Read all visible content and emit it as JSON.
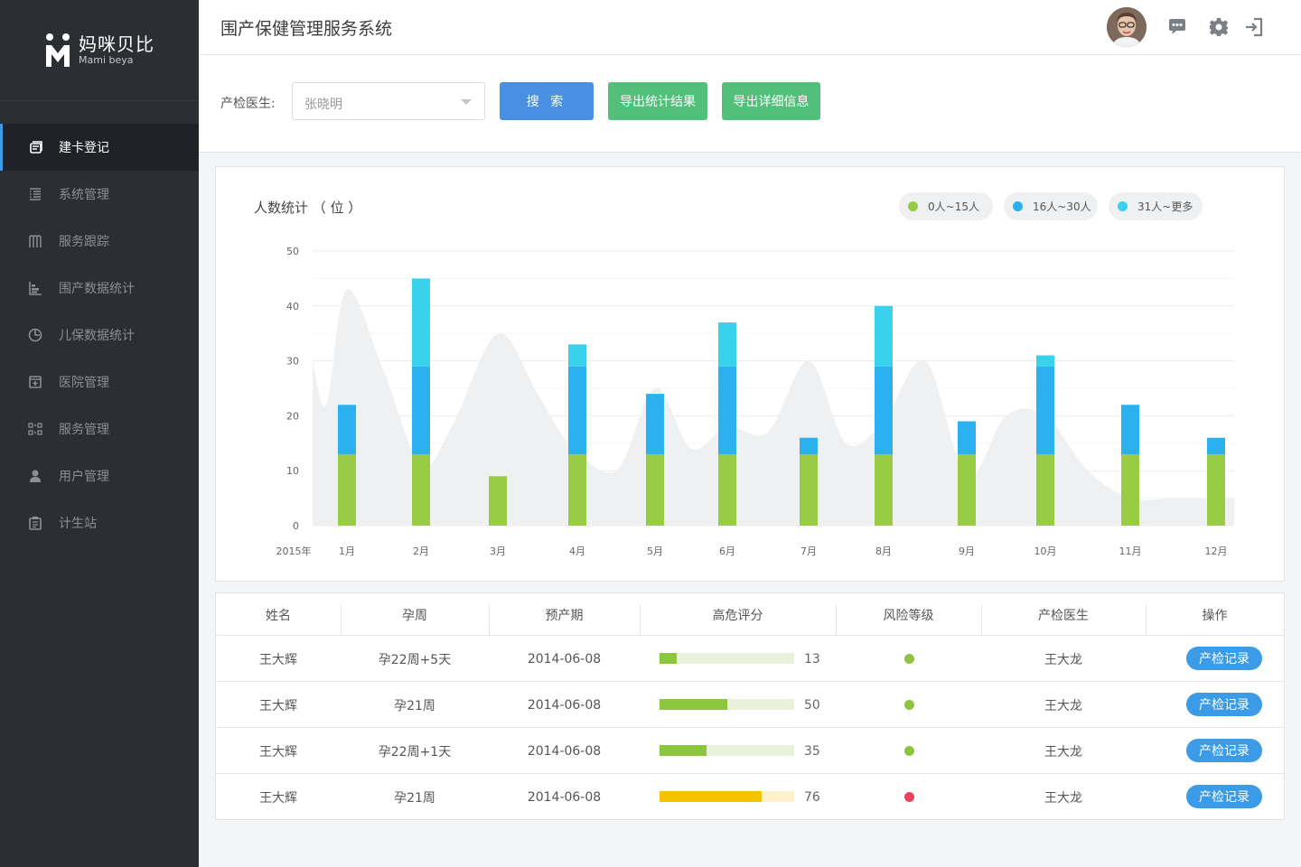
{
  "brand": {
    "name_cn": "妈咪贝比",
    "name_en": "Mami beya"
  },
  "sidebar": {
    "items": [
      {
        "label": "建卡登记",
        "icon": "card-icon",
        "active": true
      },
      {
        "label": "系统管理",
        "icon": "list-icon",
        "active": false
      },
      {
        "label": "服务跟踪",
        "icon": "track-icon",
        "active": false
      },
      {
        "label": "围产数据统计",
        "icon": "bar-chart-icon",
        "active": false
      },
      {
        "label": "儿保数据统计",
        "icon": "pie-chart-icon",
        "active": false
      },
      {
        "label": "医院管理",
        "icon": "hospital-icon",
        "active": false
      },
      {
        "label": "服务管理",
        "icon": "service-icon",
        "active": false
      },
      {
        "label": "用户管理",
        "icon": "user-icon",
        "active": false
      },
      {
        "label": "计生站",
        "icon": "clipboard-icon",
        "active": false
      }
    ]
  },
  "header": {
    "title": "围产保健管理服务系统"
  },
  "filter": {
    "label": "产检医生:",
    "doctor_value": "张晓明",
    "search_label": "搜 索",
    "export_stats_label": "导出统计结果",
    "export_detail_label": "导出详细信息"
  },
  "colors": {
    "green": "#99cc45",
    "blue": "#2bb1f0",
    "cyan": "#38d2ec",
    "area": "#eef0f2",
    "accent": "#3b9be6",
    "risk_low": "#8cc63f",
    "risk_high": "#f0405a"
  },
  "chart_data": {
    "type": "bar",
    "title": "人数统计 （ 位 ）",
    "x_origin_label": "2015年",
    "categories": [
      "1月",
      "2月",
      "3月",
      "4月",
      "5月",
      "6月",
      "7月",
      "8月",
      "9月",
      "10月",
      "11月",
      "12月"
    ],
    "stacked": true,
    "ylim": [
      0,
      50
    ],
    "yticks": [
      0,
      10,
      20,
      30,
      40,
      50
    ],
    "series": [
      {
        "name": "0人~15人",
        "color": "#99cc45",
        "values": [
          13,
          13,
          9,
          13,
          13,
          13,
          13,
          13,
          13,
          13,
          13,
          13
        ]
      },
      {
        "name": "16人~30人",
        "color": "#2bb1f0",
        "values": [
          9,
          16,
          0,
          16,
          11,
          16,
          3,
          16,
          6,
          16,
          9,
          3
        ]
      },
      {
        "name": "31人~更多",
        "color": "#38d2ec",
        "values": [
          0,
          16,
          0,
          4,
          0,
          8,
          0,
          11,
          0,
          2,
          0,
          0
        ]
      }
    ],
    "background_area": {
      "x": [
        0,
        0.4,
        1.0,
        1.5,
        2.0,
        2.4,
        3.0,
        3.5,
        3.9,
        4.5,
        5.0,
        5.5,
        6.0,
        6.5,
        7.0,
        7.5,
        8.0,
        8.5,
        9.0,
        9.5,
        10.0,
        10.5,
        11.0,
        11.5
      ],
      "y": [
        30,
        22,
        43,
        28,
        11,
        18,
        35,
        24,
        15,
        10,
        25,
        14,
        18,
        17,
        30,
        15,
        19,
        30,
        9,
        20,
        20,
        10,
        5,
        5
      ]
    },
    "grid": true
  },
  "table": {
    "headers": [
      "姓名",
      "孕周",
      "预产期",
      "高危评分",
      "风险等级",
      "产检医生",
      "操作"
    ],
    "action_label": "产检记录",
    "rows": [
      {
        "name": "王大辉",
        "week": "孕22周+5天",
        "due": "2014-06-08",
        "score": 13,
        "score_color": "#8cc63f",
        "track_color": "#e9f1dc",
        "risk": "#8cc63f",
        "doctor": "王大龙"
      },
      {
        "name": "王大辉",
        "week": "孕21周",
        "due": "2014-06-08",
        "score": 50,
        "score_color": "#8cc63f",
        "track_color": "#e9f1dc",
        "risk": "#8cc63f",
        "doctor": "王大龙"
      },
      {
        "name": "王大辉",
        "week": "孕22周+1天",
        "due": "2014-06-08",
        "score": 35,
        "score_color": "#8cc63f",
        "track_color": "#e9f1dc",
        "risk": "#8cc63f",
        "doctor": "王大龙"
      },
      {
        "name": "王大辉",
        "week": "孕21周",
        "due": "2014-06-08",
        "score": 76,
        "score_color": "#f5c300",
        "track_color": "#fdf2cc",
        "risk": "#f0405a",
        "doctor": "王大龙"
      }
    ]
  }
}
